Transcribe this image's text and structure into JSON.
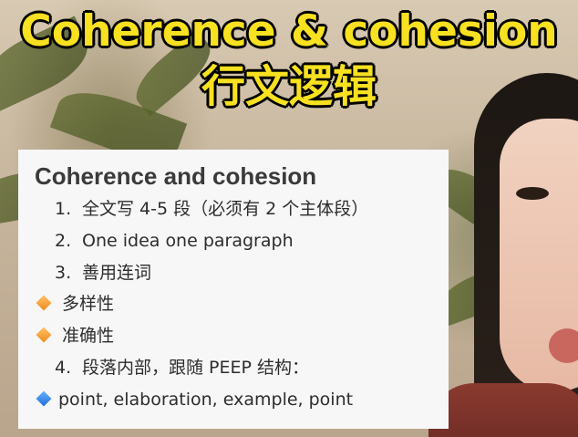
{
  "headline": {
    "english": "Coherence & cohesion",
    "chinese": "行文逻辑"
  },
  "note": {
    "title": "Coherence and cohesion",
    "items": [
      {
        "kind": "numbered",
        "number": "1.",
        "text": "全文写 4-5 段（必须有 2 个主体段）"
      },
      {
        "kind": "numbered",
        "number": "2.",
        "text": "One idea one paragraph"
      },
      {
        "kind": "numbered",
        "number": "3.",
        "text": "善用连词"
      },
      {
        "kind": "bullet",
        "icon": "orange-diamond-icon",
        "text": "多样性"
      },
      {
        "kind": "bullet",
        "icon": "orange-diamond-icon",
        "text": "准确性"
      },
      {
        "kind": "numbered",
        "number": "4.",
        "text": "段落内部，跟随 PEEP 结构："
      },
      {
        "kind": "bullet",
        "icon": "blue-diamond-icon",
        "text": "point, elaboration, example, point"
      }
    ]
  },
  "colors": {
    "headline_fill": "#f7e120",
    "headline_outline": "#000000",
    "card_background": "#f7f7f8",
    "orange_diamond": "#f08a1c",
    "blue_diamond": "#1f6fd9"
  }
}
